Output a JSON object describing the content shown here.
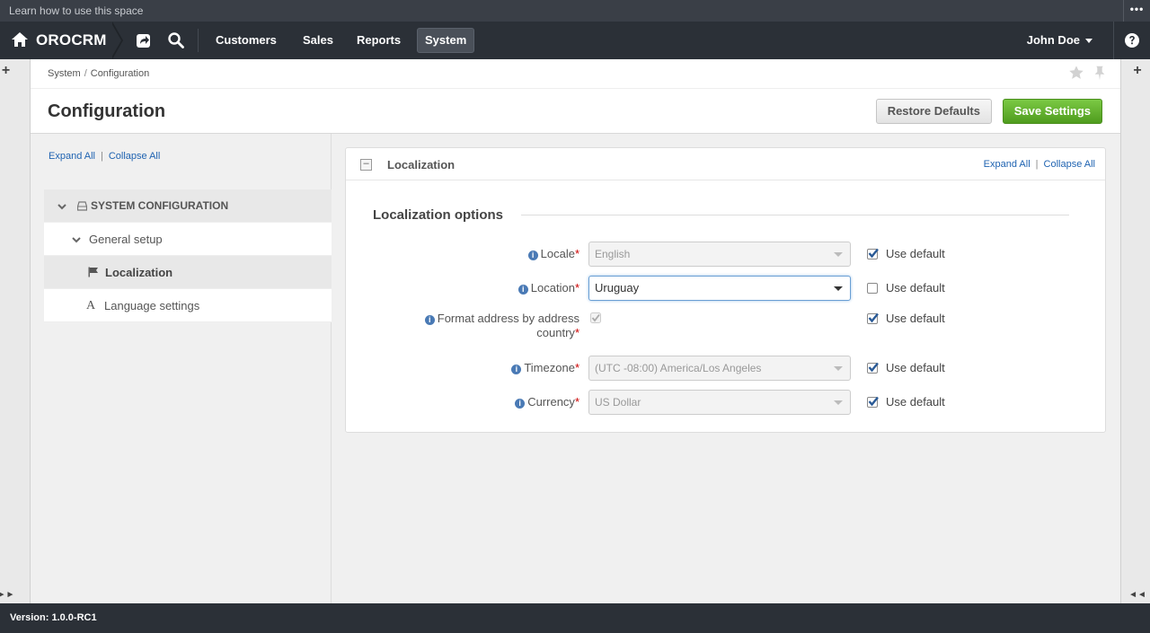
{
  "top_strip": {
    "text": "Learn how to use this space",
    "menu_glyph": "•••"
  },
  "nav": {
    "brand": "OROCRM",
    "menu": [
      {
        "label": "Customers"
      },
      {
        "label": "Sales"
      },
      {
        "label": "Reports"
      },
      {
        "label": "System"
      }
    ],
    "active_menu": "System",
    "user": "John Doe"
  },
  "breadcrumb": {
    "first": "System",
    "separator": "/",
    "second": "Configuration"
  },
  "page": {
    "title": "Configuration",
    "restore_label": "Restore Defaults",
    "save_label": "Save Settings"
  },
  "tree": {
    "expand_all": "Expand All",
    "collapse_all": "Collapse All",
    "divider": "|",
    "items": [
      {
        "label": "SYSTEM CONFIGURATION",
        "level": 0
      },
      {
        "label": "General setup",
        "level": 1
      },
      {
        "label": "Localization",
        "level": 2,
        "active": true
      },
      {
        "label": "Language settings",
        "level": 2
      }
    ]
  },
  "section": {
    "title": "Localization",
    "expand_all": "Expand All",
    "collapse_all": "Collapse All",
    "subtitle": "Localization options",
    "use_default": "Use default",
    "fields": [
      {
        "label": "Locale",
        "value": "English",
        "use_default": true
      },
      {
        "label": "Location",
        "value": "Uruguay",
        "use_default": false
      },
      {
        "label_line1": "Format address by address",
        "label_line2": "country",
        "checked": true,
        "use_default": true
      },
      {
        "label": "Timezone",
        "value": "(UTC -08:00) America/Los Angeles",
        "use_default": true
      },
      {
        "label": "Currency",
        "value": "US Dollar",
        "use_default": true
      }
    ]
  },
  "footer": {
    "version": "Version: 1.0.0-RC1"
  },
  "colors": {
    "nav_bg": "#2b3037",
    "save_green": "#5aa82a",
    "link_blue": "#1f63b1",
    "required_red": "#cc0000"
  }
}
